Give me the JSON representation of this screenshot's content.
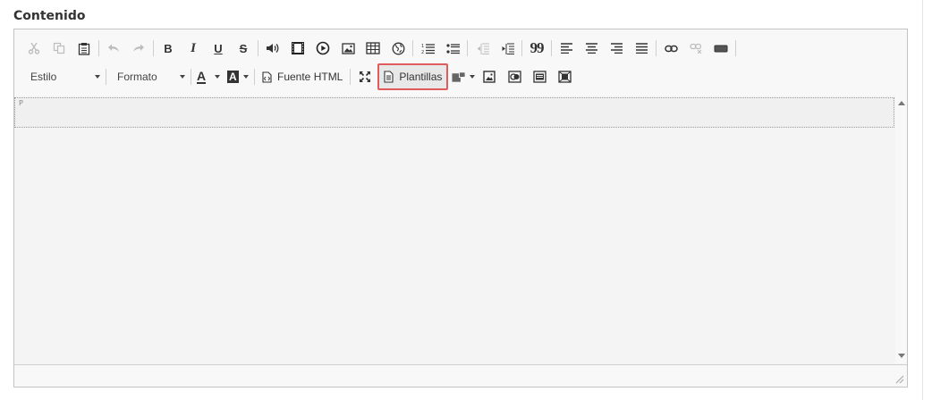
{
  "field": {
    "label": "Contenido"
  },
  "toolbar": {
    "row1": [
      "cut-icon",
      "copy-icon",
      "paste-icon",
      "sep",
      "undo-icon",
      "redo-icon",
      "sep",
      "bold",
      "italic",
      "underline",
      "strike",
      "sep",
      "audio-icon",
      "video-icon",
      "media-play-icon",
      "image-icon",
      "table-icon",
      "globe-icon",
      "sep",
      "ordered-list-icon",
      "unordered-list-icon",
      "sep",
      "outdent-icon",
      "indent-icon",
      "sep",
      "blockquote",
      "align-left-icon",
      "align-center-icon",
      "align-right-icon",
      "align-justify-icon",
      "sep",
      "link-icon",
      "unlink-icon",
      "horizontal-rule-icon"
    ],
    "labels": {
      "bold": "B",
      "italic": "I",
      "underline": "U",
      "strike": "S",
      "blockquote": "99"
    },
    "style_combo": "Estilo",
    "format_combo": "Formato",
    "text_color_letter": "A",
    "bg_color_letter": "A",
    "source_label": "Fuente HTML",
    "templates_label": "Plantillas"
  },
  "editor": {
    "block_tag": "P"
  },
  "colors": {
    "highlight_border": "#e05c5c",
    "toolbar_bg": "#f8f8f8",
    "content_bg": "#f4f4f4"
  }
}
